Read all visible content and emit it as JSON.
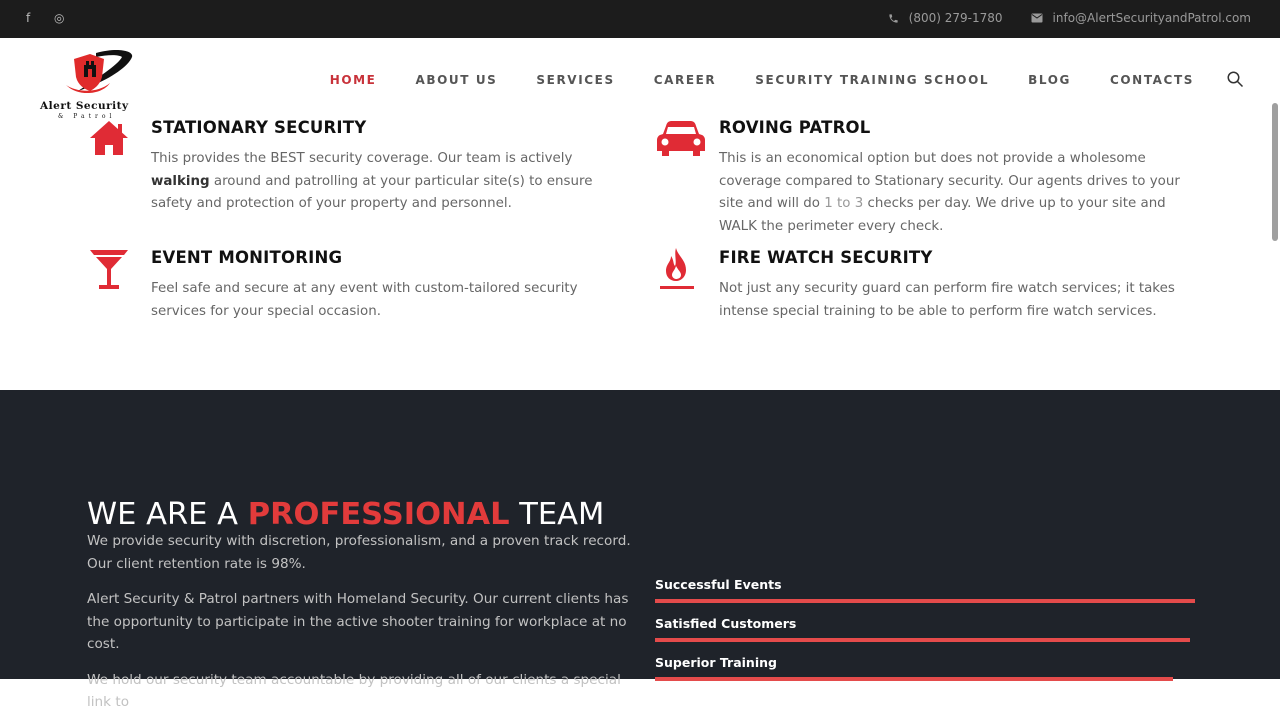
{
  "topbar": {
    "social": [
      {
        "icon": "facebook-icon",
        "glyph": "f"
      },
      {
        "icon": "instagram-icon",
        "glyph": "◎"
      }
    ],
    "phone": "(800) 279-1780",
    "email": "info@AlertSecurityandPatrol.com"
  },
  "logo": {
    "line1": "Alert Security",
    "line2": "& Patrol"
  },
  "nav": {
    "items": [
      "HOME",
      "ABOUT US",
      "SERVICES",
      "CAREER",
      "SECURITY TRAINING SCHOOL",
      "BLOG",
      "CONTACTS"
    ],
    "active": "HOME"
  },
  "features": [
    {
      "icon": "house-icon",
      "title": "STATIONARY SECURITY",
      "body_pre": "This provides the BEST security coverage. Our team is actively ",
      "body_bold": "walking",
      "body_post": " around and patrolling at your particular site(s) to ensure safety and protection of your property and personnel."
    },
    {
      "icon": "car-icon",
      "title": "ROVING PATROL",
      "body_pre": "This is an economical option but does not provide a wholesome coverage compared to Stationary security. Our agents drives to your site and will do ",
      "body_muted": "1 to 3",
      "body_post": " checks per day. We drive up to your site and WALK the perimeter every check."
    },
    {
      "icon": "cocktail-glass-icon",
      "title": "EVENT MONITORING",
      "body": "Feel safe and secure at any event with custom-tailored security services for your special occasion."
    },
    {
      "icon": "flame-icon",
      "title": "FIRE WATCH SECURITY",
      "body": "Not just any security guard can perform fire watch services; it takes intense special training to be able to perform fire watch services."
    }
  ],
  "professional": {
    "title_pre": "WE ARE A ",
    "title_red": "PROFESSIONAL",
    "title_post": " TEAM",
    "paragraphs": [
      "We provide security with discretion, professionalism, and a proven track record. Our client retention rate is 98%.",
      "Alert Security & Patrol partners with Homeland Security. Our current clients has the opportunity to participate in the active shooter training for workplace at no cost.",
      "We hold our security team accountable by providing all of our clients a special link to"
    ]
  },
  "skills": [
    {
      "label": "Successful Events",
      "percent": 100
    },
    {
      "label": "Satisfied Customers",
      "percent": 99
    },
    {
      "label": "Superior Training",
      "percent": 96
    }
  ],
  "colors": {
    "accent": "#e23b3b",
    "dark_bg": "#1f232a",
    "topbar_bg": "#1c1c1c"
  }
}
